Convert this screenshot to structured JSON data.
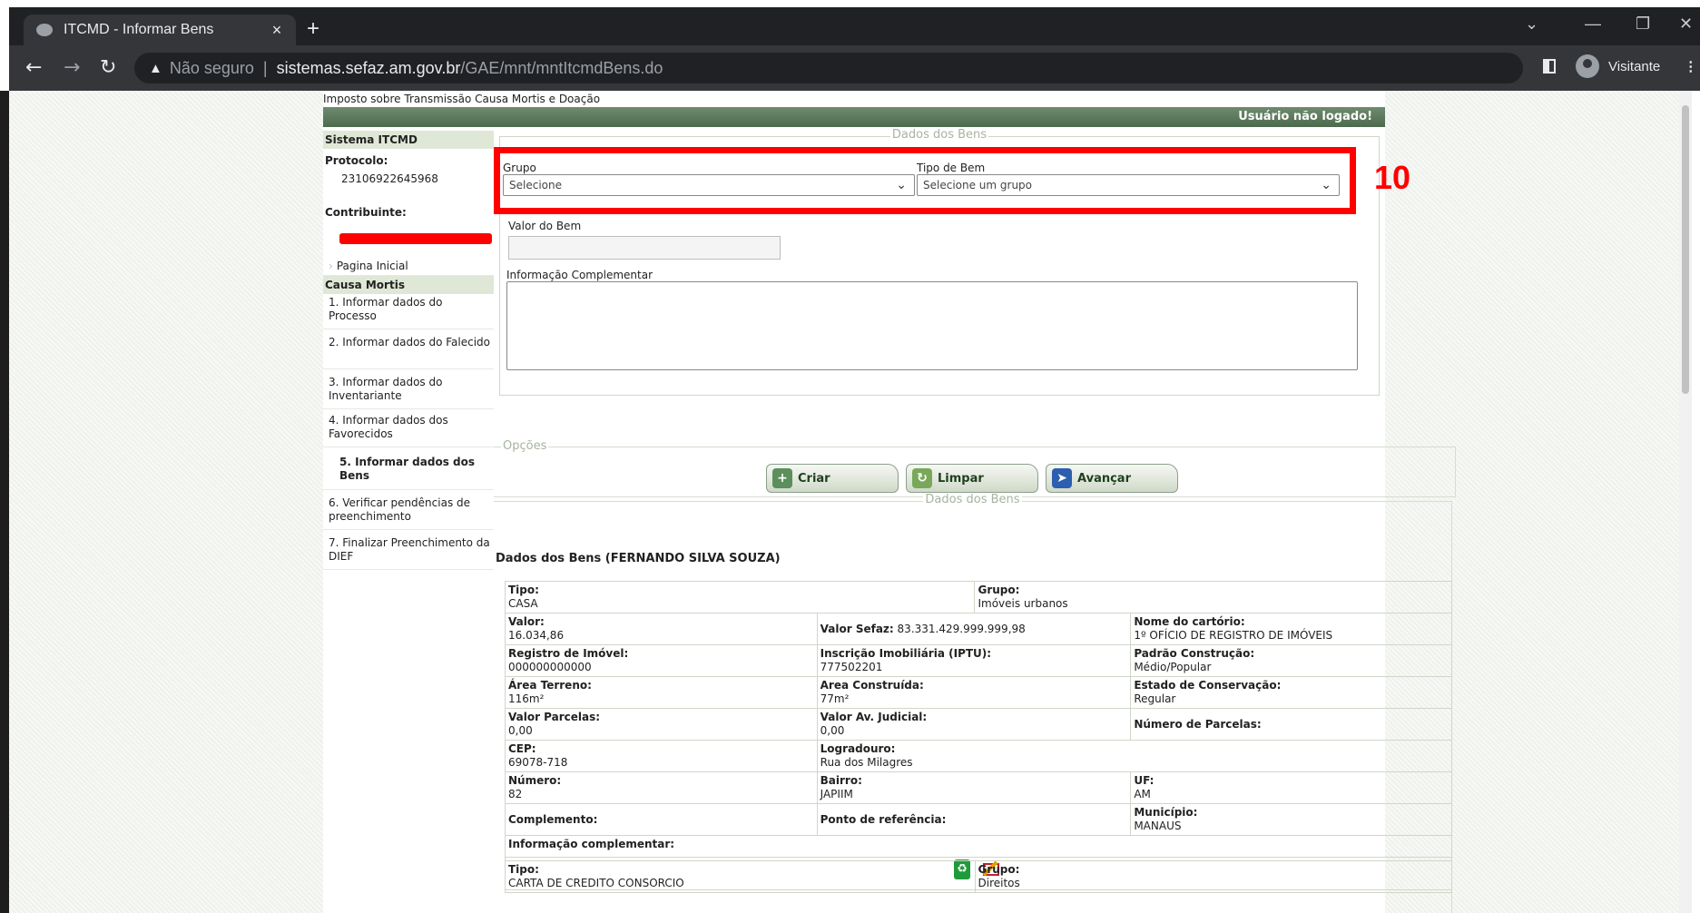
{
  "browser": {
    "tab_title": "ITCMD - Informar Bens",
    "tab_close": "×",
    "new_tab": "+",
    "not_secure": "Não seguro",
    "url_host": "sistemas.sefaz.am.gov.br",
    "url_path": "/GAE/mnt/mntItcmdBens.do",
    "profile_label": "Visitante"
  },
  "header": {
    "site_title": "Imposto sobre Transmissão Causa Mortis e Doação",
    "user_status": "Usuário não logado!"
  },
  "sidebar": {
    "system_title": "Sistema ITCMD",
    "protocolo_label": "Protocolo:",
    "protocolo_value": "23106922645968",
    "contribuinte_label": "Contribuinte:",
    "home_label": "Pagina Inicial",
    "section_label": "Causa Mortis",
    "steps": [
      "1. Informar dados do Processo",
      "2. Informar dados do Falecido",
      "3. Informar dados do Inventariante",
      "4. Informar dados dos Favorecidos",
      "5. Informar dados dos Bens",
      "6. Verificar pendências de preenchimento",
      "7. Finalizar Preenchimento da DIEF"
    ],
    "active_step": 4
  },
  "form": {
    "legend": "Dados dos Bens",
    "grupo_label": "Grupo",
    "grupo_value": "Selecione",
    "tipo_label": "Tipo de Bem",
    "tipo_value": "Selecione um grupo",
    "valor_label": "Valor do Bem",
    "valor_value": "",
    "info_label": "Informação Complementar",
    "info_value": ""
  },
  "annotation": {
    "number": "10",
    "color": "#ff0000"
  },
  "options": {
    "legend": "Opções",
    "criar": "Criar",
    "limpar": "Limpar",
    "avancar": "Avançar"
  },
  "listing": {
    "legend": "Dados dos Bens",
    "title": "Dados dos Bens (FERNANDO SILVA SOUZA)",
    "item1": {
      "tipo_label": "Tipo:",
      "tipo": "CASA",
      "grupo_label": "Grupo:",
      "grupo": "Imóveis urbanos",
      "valor_label": "Valor:",
      "valor": "16.034,86",
      "valor_sefaz_label": "Valor Sefaz:",
      "valor_sefaz": "83.331.429.999.999,98",
      "cartorio_label": "Nome do cartório:",
      "cartorio": "1º OFÍCIO DE REGISTRO DE IMÓVEIS",
      "registro_label": "Registro de Imóvel:",
      "registro": "000000000000",
      "iptu_label": "Inscrição Imobiliária (IPTU):",
      "iptu": "777502201",
      "padrao_label": "Padrão Construção:",
      "padrao": "Médio/Popular",
      "area_terreno_label": "Área Terreno:",
      "area_terreno": "116m²",
      "area_construida_label": "Area Construída:",
      "area_construida": "77m²",
      "estado_label": "Estado de Conservação:",
      "estado": "Regular",
      "valor_parcelas_label": "Valor Parcelas:",
      "valor_parcelas": "0,00",
      "valor_judicial_label": "Valor Av. Judicial:",
      "valor_judicial": "0,00",
      "num_parcelas_label": "Número de Parcelas:",
      "cep_label": "CEP:",
      "cep": "69078-718",
      "logradouro_label": "Logradouro:",
      "logradouro": "Rua dos Milagres",
      "numero_label": "Número:",
      "numero": "82",
      "bairro_label": "Bairro:",
      "bairro": "JAPIIM",
      "uf_label": "UF:",
      "uf": "AM",
      "complemento_label": "Complemento:",
      "referencia_label": "Ponto de referência:",
      "municipio_label": "Município:",
      "municipio": "MANAUS",
      "info_label": "Informação complementar:"
    },
    "item2": {
      "tipo_label": "Tipo:",
      "tipo": "CARTA DE CREDITO CONSORCIO",
      "grupo_label": "Grupo:",
      "grupo": "Direitos"
    }
  }
}
